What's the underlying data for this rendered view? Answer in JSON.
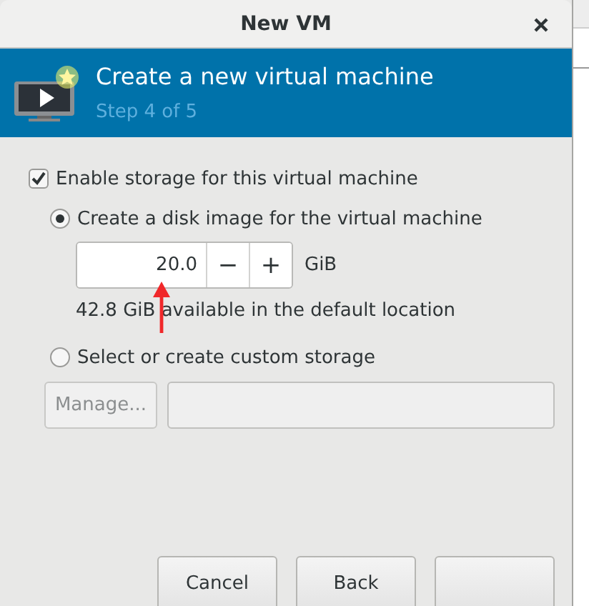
{
  "window": {
    "title": "New VM"
  },
  "header": {
    "title": "Create a new virtual machine",
    "step": "Step 4 of 5"
  },
  "storage": {
    "enable": {
      "label": "Enable storage for this virtual machine",
      "checked": true
    },
    "options": [
      {
        "kind": "disk",
        "label": "Create a disk image for the virtual machine",
        "selected": true,
        "size": "20.0",
        "decrement": "−",
        "increment": "+",
        "unit": "GiB",
        "note": "42.8 GiB available in the default location"
      },
      {
        "kind": "custom",
        "label": "Select or create custom storage",
        "selected": false,
        "manage": "Manage...",
        "disabled": true
      }
    ]
  },
  "buttons": [
    {
      "label": "Cancel"
    },
    {
      "label": "Back"
    }
  ],
  "covered_button": true
}
